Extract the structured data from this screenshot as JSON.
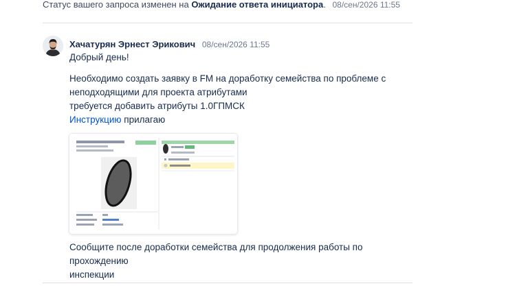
{
  "status_event": {
    "prefix": "Статус вашего запроса изменен на",
    "status": "Ожидание ответа инициатора",
    "suffix": ".",
    "timestamp": "08/сен/2026 11:55"
  },
  "comment": {
    "author": "Хачатурян Эрнест Эрикович",
    "timestamp": "08/сен/2026 11:55",
    "greeting": "Добрый день!",
    "line1": "Необходимо создать заявку в FM на доработку семейства по проблеме с",
    "line2": "неподходящими для проекта атрибутами",
    "line3": "требуется добавить атрибуты 1.0ГПМСК",
    "instruction_link": "Инструкцию",
    "instruction_suffix": " прилагаю",
    "closing_line1": "Сообщите после доработки семейства для продолжения работы по прохождению",
    "closing_line2": "инспекции"
  },
  "colors": {
    "link": "#0052cc",
    "text": "#172b4d",
    "muted": "#6b778c",
    "divider": "#dfe1e6"
  }
}
